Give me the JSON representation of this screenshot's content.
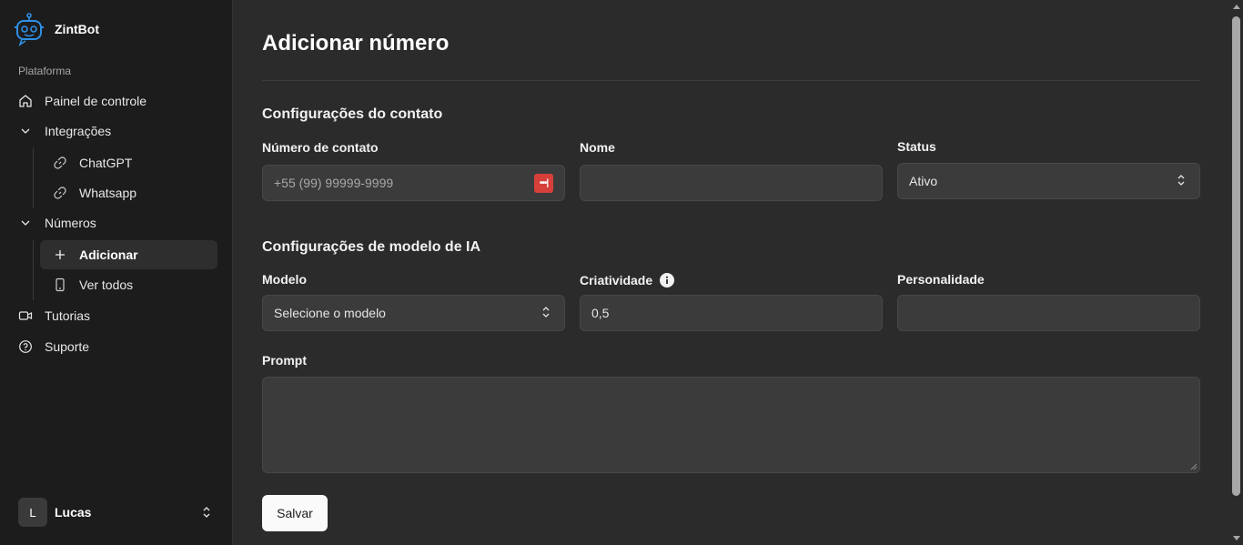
{
  "brand": {
    "name": "ZintBot"
  },
  "sidebar": {
    "section_label": "Plataforma",
    "items": [
      {
        "label": "Painel de controle",
        "icon": "home-icon"
      },
      {
        "label": "Integrações",
        "icon": "chevron-down-icon",
        "children": [
          {
            "label": "ChatGPT",
            "icon": "link-icon"
          },
          {
            "label": "Whatsapp",
            "icon": "link-icon"
          }
        ]
      },
      {
        "label": "Números",
        "icon": "chevron-down-icon",
        "children": [
          {
            "label": "Adicionar",
            "icon": "plus-icon",
            "active": true
          },
          {
            "label": "Ver todos",
            "icon": "phone-icon"
          }
        ]
      },
      {
        "label": "Tutorias",
        "icon": "video-icon"
      },
      {
        "label": "Suporte",
        "icon": "help-circle-icon"
      }
    ],
    "user": {
      "initial": "L",
      "name": "Lucas"
    }
  },
  "main": {
    "title": "Adicionar número",
    "contact_section": {
      "title": "Configurações do contato",
      "phone": {
        "label": "Número de contato",
        "placeholder": "+55 (99) 99999-9999",
        "value": ""
      },
      "name": {
        "label": "Nome",
        "value": ""
      },
      "status": {
        "label": "Status",
        "value": "Ativo"
      }
    },
    "ai_section": {
      "title": "Configurações de modelo de IA",
      "model": {
        "label": "Modelo",
        "value": "Selecione o modelo"
      },
      "creativity": {
        "label": "Criatividade",
        "value": "0,5"
      },
      "personality": {
        "label": "Personalidade",
        "value": ""
      }
    },
    "prompt": {
      "label": "Prompt",
      "value": ""
    },
    "save_label": "Salvar",
    "password_manager_glyph": "•••|"
  },
  "colors": {
    "accent": "#d7403a",
    "sidebar_bg": "#1c1c1c",
    "main_bg": "#2b2b2b",
    "field_bg": "#3b3b3b"
  }
}
